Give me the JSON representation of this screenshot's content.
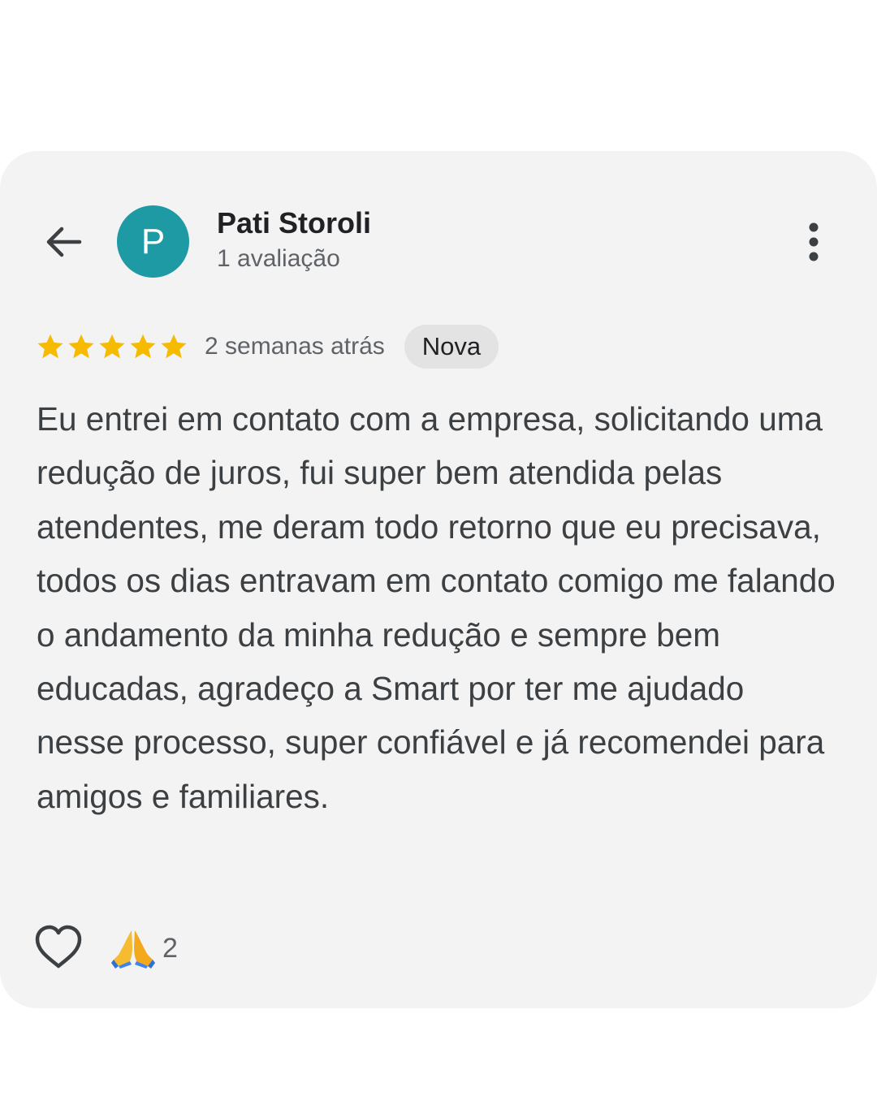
{
  "reviewer": {
    "avatar_letter": "P",
    "avatar_color": "#1d9aa4",
    "name": "Pati Storoli",
    "review_count": "1 avaliação"
  },
  "review": {
    "rating": 5,
    "max_rating": 5,
    "star_color": "#f6bb00",
    "time_ago": "2 semanas atrás",
    "badge": "Nova",
    "text": "Eu entrei em contato com a empresa, solicitando uma redução de juros, fui super bem atendida pelas atendentes, me deram todo retorno que eu precisava, todos os dias entravam em contato comigo me falando o andamento da minha redução e sempre bem educadas, agradeço a Smart por ter me ajudado nesse processo, super confiável e já recomendei para amigos e familiares."
  },
  "reactions": {
    "like_icon": "heart-outline-icon",
    "emoji_icon": "folded-hands-icon",
    "count": "2"
  },
  "icons": {
    "back": "arrow-back-icon",
    "menu": "more-vert-icon"
  }
}
